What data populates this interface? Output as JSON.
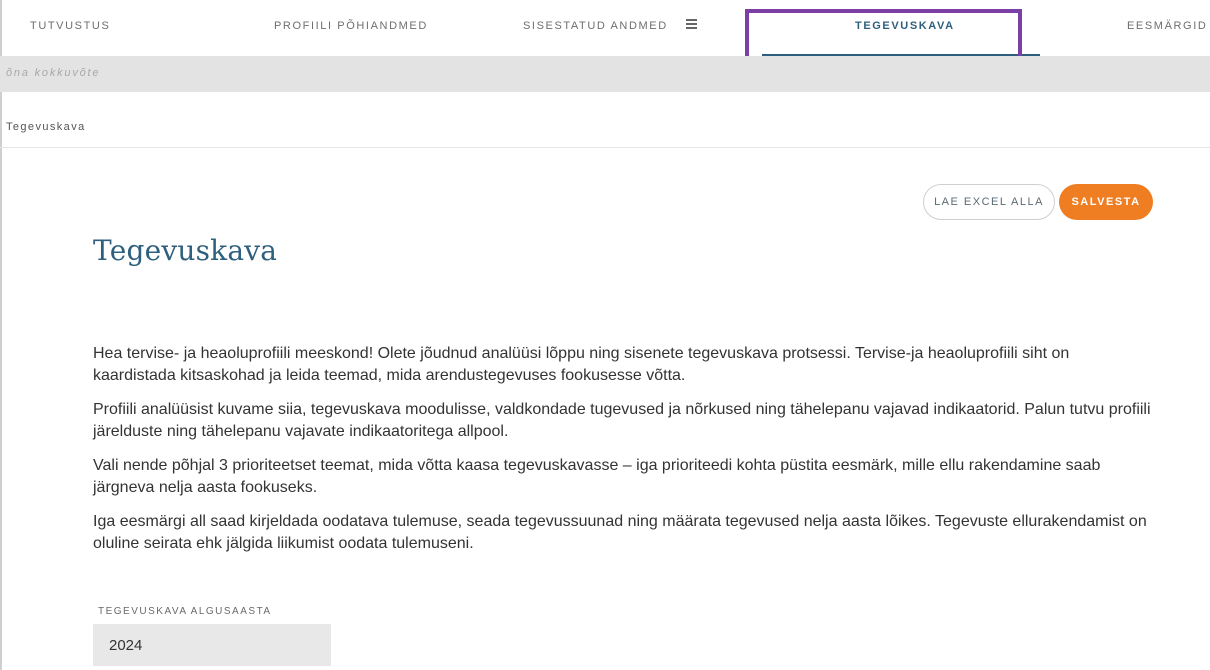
{
  "tabs": [
    {
      "label": "TUTVUSTUS",
      "active": false
    },
    {
      "label": "PROFIILI PÕHIANDMED",
      "active": false
    },
    {
      "label": "SISESTATUD ANDMED",
      "active": false,
      "icon": "menu-icon"
    },
    {
      "label": "TEGEVUSKAVA",
      "active": true
    },
    {
      "label": "EESMÄRGID",
      "active": false
    }
  ],
  "summary_bar": {
    "label": "õna kokkuvõte"
  },
  "breadcrumb": {
    "label": "Tegevuskava"
  },
  "actions": {
    "download_label": "LAE EXCEL ALLA",
    "save_label": "SALVESTA"
  },
  "page": {
    "title": "Tegevuskava",
    "paragraphs": [
      "Hea tervise- ja heaoluprofiili meeskond! Olete jõudnud analüüsi lõppu ning sisenete tegevuskava protsessi. Tervise-ja heaoluprofiili siht on kaardistada kitsaskohad ja leida teemad, mida arendustegevuses fookusesse võtta.",
      "Profiili analüüsist kuvame siia, tegevuskava moodulisse, valdkondade tugevused ja nõrkused ning tähelepanu vajavad indikaatorid. Palun tutvu profiili järelduste ning tähelepanu vajavate indikaatoritega allpool.",
      "Vali nende põhjal 3 prioriteetset teemat, mida võtta kaasa tegevuskavasse – iga prioriteedi kohta püstita eesmärk, mille ellu rakendamine saab järgneva nelja aasta fookuseks.",
      "Iga eesmärgi all saad kirjeldada oodatava tulemuse, seada tegevussuunad ning määrata tegevused nelja aasta lõikes. Tegevuste ellurakendamist on oluline seirata ehk jälgida liikumist oodata tulemuseni."
    ]
  },
  "start_year": {
    "label": "TEGEVUSKAVA ALGUSAASTA",
    "value": "2024"
  },
  "colors": {
    "accent_blue": "#2f5f7e",
    "save_orange": "#ef7d22",
    "highlight_purple": "#7b3fa6",
    "summary_bar_grey": "#e3e3e3"
  }
}
